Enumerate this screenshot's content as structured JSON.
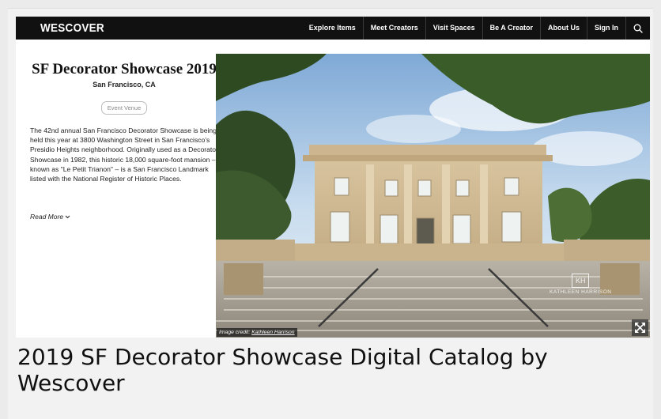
{
  "header": {
    "logo": "WESCOVER",
    "nav": [
      "Explore Items",
      "Meet Creators",
      "Visit Spaces",
      "Be A Creator",
      "About Us",
      "Sign In"
    ],
    "search_icon": "search-icon"
  },
  "venue": {
    "title": "SF Decorator Showcase 2019",
    "location": "San Francisco, CA",
    "tag": "Event Venue",
    "description": "The 42nd annual San Francisco Decorator Showcase is being held this year at 3800 Washington Street in San Francisco's Presidio Heights neighborhood. Originally used as a Decorator Showcase in 1982, this historic 18,000 square-foot mansion – known as \"Le Petit Trianon\" – is a San Francisco Landmark listed with the National Register of Historic Places.",
    "read_more": "Read More"
  },
  "photo": {
    "credit_prefix": "Image credit:",
    "credit_name": "Kathleen Harrison",
    "watermark": "KATHLEEN HARRISON",
    "expand_icon": "expand-icon"
  },
  "page": {
    "title": "2019 SF Decorator Showcase Digital Catalog by Wescover"
  },
  "colors": {
    "topbar": "#111111",
    "background": "#ebebeb"
  }
}
